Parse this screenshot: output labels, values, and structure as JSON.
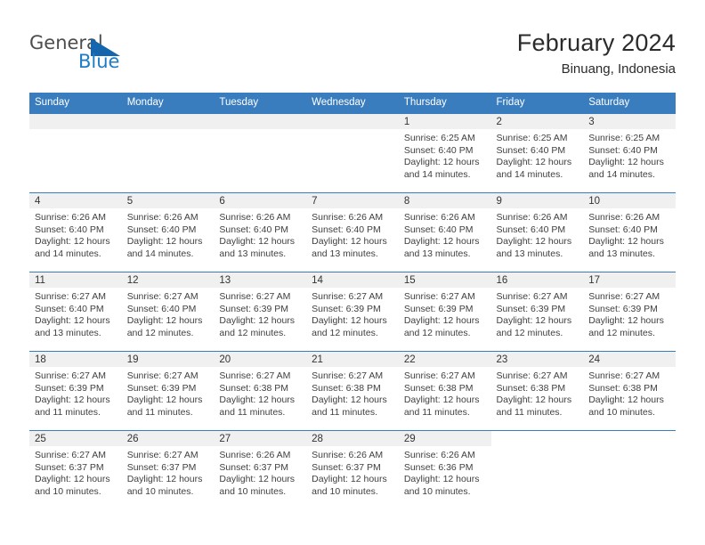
{
  "brand": {
    "word1": "General",
    "word2": "Blue",
    "accent_color": "#1666ad",
    "text_color": "#4d4d4d"
  },
  "header": {
    "title": "February 2024",
    "location": "Binuang, Indonesia"
  },
  "calendar": {
    "header_bg": "#3a7dbf",
    "daynum_bg": "#f0f0f0",
    "weekdays": [
      "Sunday",
      "Monday",
      "Tuesday",
      "Wednesday",
      "Thursday",
      "Friday",
      "Saturday"
    ],
    "labels": {
      "sunrise": "Sunrise:",
      "sunset": "Sunset:",
      "daylight": "Daylight:"
    },
    "weeks": [
      [
        {
          "day": "",
          "empty": true
        },
        {
          "day": "",
          "empty": true
        },
        {
          "day": "",
          "empty": true
        },
        {
          "day": "",
          "empty": true
        },
        {
          "day": "1",
          "sunrise": "Sunrise: 6:25 AM",
          "sunset": "Sunset: 6:40 PM",
          "daylight_1": "Daylight: 12 hours",
          "daylight_2": "and 14 minutes."
        },
        {
          "day": "2",
          "sunrise": "Sunrise: 6:25 AM",
          "sunset": "Sunset: 6:40 PM",
          "daylight_1": "Daylight: 12 hours",
          "daylight_2": "and 14 minutes."
        },
        {
          "day": "3",
          "sunrise": "Sunrise: 6:25 AM",
          "sunset": "Sunset: 6:40 PM",
          "daylight_1": "Daylight: 12 hours",
          "daylight_2": "and 14 minutes."
        }
      ],
      [
        {
          "day": "4",
          "sunrise": "Sunrise: 6:26 AM",
          "sunset": "Sunset: 6:40 PM",
          "daylight_1": "Daylight: 12 hours",
          "daylight_2": "and 14 minutes."
        },
        {
          "day": "5",
          "sunrise": "Sunrise: 6:26 AM",
          "sunset": "Sunset: 6:40 PM",
          "daylight_1": "Daylight: 12 hours",
          "daylight_2": "and 14 minutes."
        },
        {
          "day": "6",
          "sunrise": "Sunrise: 6:26 AM",
          "sunset": "Sunset: 6:40 PM",
          "daylight_1": "Daylight: 12 hours",
          "daylight_2": "and 13 minutes."
        },
        {
          "day": "7",
          "sunrise": "Sunrise: 6:26 AM",
          "sunset": "Sunset: 6:40 PM",
          "daylight_1": "Daylight: 12 hours",
          "daylight_2": "and 13 minutes."
        },
        {
          "day": "8",
          "sunrise": "Sunrise: 6:26 AM",
          "sunset": "Sunset: 6:40 PM",
          "daylight_1": "Daylight: 12 hours",
          "daylight_2": "and 13 minutes."
        },
        {
          "day": "9",
          "sunrise": "Sunrise: 6:26 AM",
          "sunset": "Sunset: 6:40 PM",
          "daylight_1": "Daylight: 12 hours",
          "daylight_2": "and 13 minutes."
        },
        {
          "day": "10",
          "sunrise": "Sunrise: 6:26 AM",
          "sunset": "Sunset: 6:40 PM",
          "daylight_1": "Daylight: 12 hours",
          "daylight_2": "and 13 minutes."
        }
      ],
      [
        {
          "day": "11",
          "sunrise": "Sunrise: 6:27 AM",
          "sunset": "Sunset: 6:40 PM",
          "daylight_1": "Daylight: 12 hours",
          "daylight_2": "and 13 minutes."
        },
        {
          "day": "12",
          "sunrise": "Sunrise: 6:27 AM",
          "sunset": "Sunset: 6:40 PM",
          "daylight_1": "Daylight: 12 hours",
          "daylight_2": "and 12 minutes."
        },
        {
          "day": "13",
          "sunrise": "Sunrise: 6:27 AM",
          "sunset": "Sunset: 6:39 PM",
          "daylight_1": "Daylight: 12 hours",
          "daylight_2": "and 12 minutes."
        },
        {
          "day": "14",
          "sunrise": "Sunrise: 6:27 AM",
          "sunset": "Sunset: 6:39 PM",
          "daylight_1": "Daylight: 12 hours",
          "daylight_2": "and 12 minutes."
        },
        {
          "day": "15",
          "sunrise": "Sunrise: 6:27 AM",
          "sunset": "Sunset: 6:39 PM",
          "daylight_1": "Daylight: 12 hours",
          "daylight_2": "and 12 minutes."
        },
        {
          "day": "16",
          "sunrise": "Sunrise: 6:27 AM",
          "sunset": "Sunset: 6:39 PM",
          "daylight_1": "Daylight: 12 hours",
          "daylight_2": "and 12 minutes."
        },
        {
          "day": "17",
          "sunrise": "Sunrise: 6:27 AM",
          "sunset": "Sunset: 6:39 PM",
          "daylight_1": "Daylight: 12 hours",
          "daylight_2": "and 12 minutes."
        }
      ],
      [
        {
          "day": "18",
          "sunrise": "Sunrise: 6:27 AM",
          "sunset": "Sunset: 6:39 PM",
          "daylight_1": "Daylight: 12 hours",
          "daylight_2": "and 11 minutes."
        },
        {
          "day": "19",
          "sunrise": "Sunrise: 6:27 AM",
          "sunset": "Sunset: 6:39 PM",
          "daylight_1": "Daylight: 12 hours",
          "daylight_2": "and 11 minutes."
        },
        {
          "day": "20",
          "sunrise": "Sunrise: 6:27 AM",
          "sunset": "Sunset: 6:38 PM",
          "daylight_1": "Daylight: 12 hours",
          "daylight_2": "and 11 minutes."
        },
        {
          "day": "21",
          "sunrise": "Sunrise: 6:27 AM",
          "sunset": "Sunset: 6:38 PM",
          "daylight_1": "Daylight: 12 hours",
          "daylight_2": "and 11 minutes."
        },
        {
          "day": "22",
          "sunrise": "Sunrise: 6:27 AM",
          "sunset": "Sunset: 6:38 PM",
          "daylight_1": "Daylight: 12 hours",
          "daylight_2": "and 11 minutes."
        },
        {
          "day": "23",
          "sunrise": "Sunrise: 6:27 AM",
          "sunset": "Sunset: 6:38 PM",
          "daylight_1": "Daylight: 12 hours",
          "daylight_2": "and 11 minutes."
        },
        {
          "day": "24",
          "sunrise": "Sunrise: 6:27 AM",
          "sunset": "Sunset: 6:38 PM",
          "daylight_1": "Daylight: 12 hours",
          "daylight_2": "and 10 minutes."
        }
      ],
      [
        {
          "day": "25",
          "sunrise": "Sunrise: 6:27 AM",
          "sunset": "Sunset: 6:37 PM",
          "daylight_1": "Daylight: 12 hours",
          "daylight_2": "and 10 minutes."
        },
        {
          "day": "26",
          "sunrise": "Sunrise: 6:27 AM",
          "sunset": "Sunset: 6:37 PM",
          "daylight_1": "Daylight: 12 hours",
          "daylight_2": "and 10 minutes."
        },
        {
          "day": "27",
          "sunrise": "Sunrise: 6:26 AM",
          "sunset": "Sunset: 6:37 PM",
          "daylight_1": "Daylight: 12 hours",
          "daylight_2": "and 10 minutes."
        },
        {
          "day": "28",
          "sunrise": "Sunrise: 6:26 AM",
          "sunset": "Sunset: 6:37 PM",
          "daylight_1": "Daylight: 12 hours",
          "daylight_2": "and 10 minutes."
        },
        {
          "day": "29",
          "sunrise": "Sunrise: 6:26 AM",
          "sunset": "Sunset: 6:36 PM",
          "daylight_1": "Daylight: 12 hours",
          "daylight_2": "and 10 minutes."
        },
        {
          "day": "",
          "blank": true
        },
        {
          "day": "",
          "blank": true
        }
      ]
    ]
  }
}
